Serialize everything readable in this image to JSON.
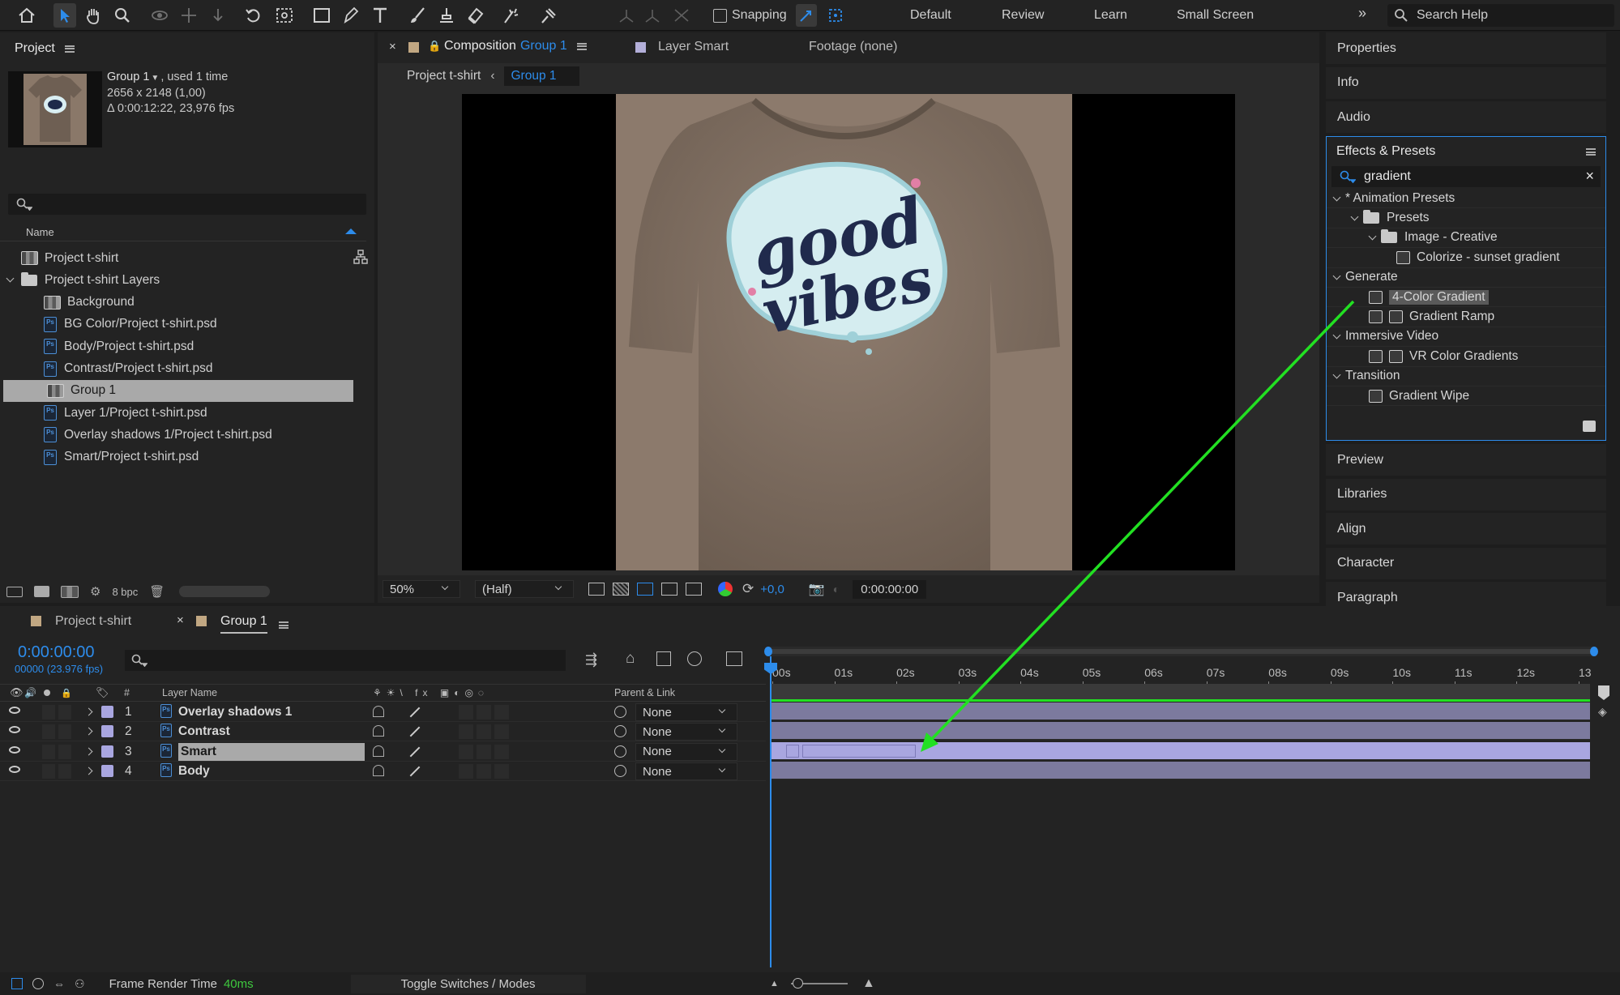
{
  "toolbar": {
    "snapping_label": "Snapping",
    "workspaces": [
      "Default",
      "Review",
      "Learn",
      "Small Screen"
    ],
    "search_help_placeholder": "Search Help"
  },
  "project_panel": {
    "title": "Project",
    "item_name": "Group 1",
    "item_used": ", used 1 time",
    "item_dims": "2656 x 2148 (1,00)",
    "item_duration": "Δ 0:00:12:22, 23,976 fps",
    "column_name": "Name",
    "bpc_label": "8 bpc",
    "items": [
      {
        "label": "Project t-shirt",
        "type": "comp",
        "indent": 0
      },
      {
        "label": "Project t-shirt Layers",
        "type": "folder",
        "indent": 0
      },
      {
        "label": "Background",
        "type": "comp",
        "indent": 1
      },
      {
        "label": "BG Color/Project t-shirt.psd",
        "type": "psd",
        "indent": 1
      },
      {
        "label": "Body/Project t-shirt.psd",
        "type": "psd",
        "indent": 1
      },
      {
        "label": "Contrast/Project t-shirt.psd",
        "type": "psd",
        "indent": 1
      },
      {
        "label": "Group 1",
        "type": "comp",
        "indent": 1,
        "selected": true
      },
      {
        "label": "Layer 1/Project t-shirt.psd",
        "type": "psd",
        "indent": 1
      },
      {
        "label": "Overlay shadows 1/Project t-shirt.psd",
        "type": "psd",
        "indent": 1
      },
      {
        "label": "Smart/Project t-shirt.psd",
        "type": "psd",
        "indent": 1
      }
    ]
  },
  "comp_panel": {
    "tab_composition_prefix": "Composition",
    "tab_composition_name": "Group 1",
    "tab_layer": "Layer Smart",
    "tab_footage": "Footage (none)",
    "breadcrumb_parent": "Project t-shirt",
    "breadcrumb_current": "Group 1",
    "zoom": "50%",
    "resolution": "(Half)",
    "exposure": "+0,0",
    "timecode": "0:00:00:00",
    "artwork_text": [
      "good",
      "vibes"
    ]
  },
  "right_panel": {
    "collapsed_top": [
      "Properties",
      "Info",
      "Audio"
    ],
    "effects_title": "Effects & Presets",
    "search_value": "gradient",
    "tree": [
      {
        "label": "* Animation Presets",
        "type": "category",
        "indent": 0
      },
      {
        "label": "Presets",
        "type": "folder",
        "indent": 1
      },
      {
        "label": "Image - Creative",
        "type": "folder",
        "indent": 2
      },
      {
        "label": "Colorize - sunset gradient",
        "type": "preset",
        "indent": 3
      },
      {
        "label": "Generate",
        "type": "category",
        "indent": 0
      },
      {
        "label": "4-Color Gradient",
        "type": "effect",
        "indent": 1,
        "highlighted": true
      },
      {
        "label": "Gradient Ramp",
        "type": "effect32",
        "indent": 1
      },
      {
        "label": "Immersive Video",
        "type": "category",
        "indent": 0
      },
      {
        "label": "VR Color Gradients",
        "type": "effect32",
        "indent": 1
      },
      {
        "label": "Transition",
        "type": "category",
        "indent": 0
      },
      {
        "label": "Gradient Wipe",
        "type": "effect",
        "indent": 1
      }
    ],
    "collapsed_bottom": [
      "Preview",
      "Libraries",
      "Align",
      "Character",
      "Paragraph"
    ]
  },
  "timeline": {
    "tab_project": "Project t-shirt",
    "tab_group": "Group 1",
    "timecode": "0:00:00:00",
    "frame_info": "00000 (23.976 fps)",
    "col_hash": "#",
    "col_layer_name": "Layer Name",
    "col_parent": "Parent & Link",
    "ruler": [
      "00s",
      "01s",
      "02s",
      "03s",
      "04s",
      "05s",
      "06s",
      "07s",
      "08s",
      "09s",
      "10s",
      "11s",
      "12s",
      "13"
    ],
    "layers": [
      {
        "num": "1",
        "name": "Overlay shadows 1",
        "parent": "None"
      },
      {
        "num": "2",
        "name": "Contrast",
        "parent": "None"
      },
      {
        "num": "3",
        "name": "Smart",
        "parent": "None",
        "selected": true
      },
      {
        "num": "4",
        "name": "Body",
        "parent": "None"
      }
    ],
    "render_label": "Frame Render Time",
    "render_value": "40ms",
    "toggle_label": "Toggle Switches / Modes"
  },
  "colors": {
    "accent_blue": "#2d8ceb",
    "annotation_green": "#22e022",
    "layer_label": "#a9a6e0",
    "shirt": "#8a7869"
  }
}
